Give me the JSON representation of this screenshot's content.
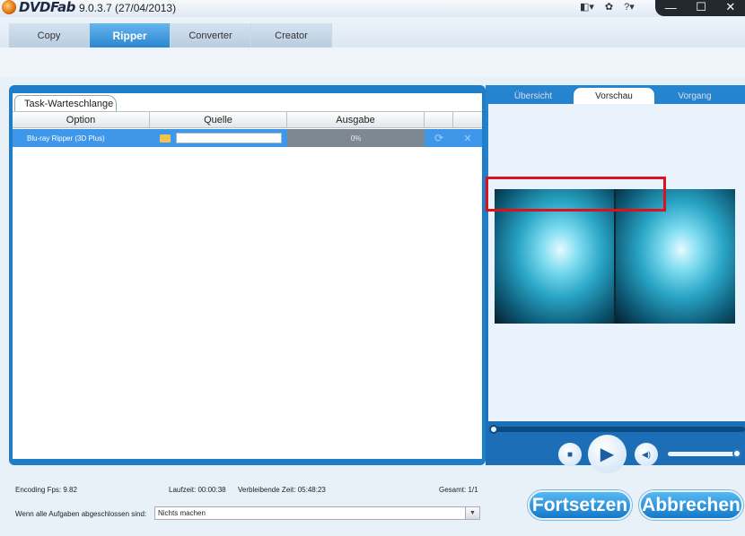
{
  "app": {
    "brand": "DVDFab",
    "version": "9.0.3.7 (27/04/2013)"
  },
  "titlebar": {
    "icons": [
      "◧▾",
      "✿",
      "?▾"
    ],
    "window_controls": [
      "—",
      "☐",
      "✕"
    ]
  },
  "tabs": [
    {
      "label": "Copy"
    },
    {
      "label": "Ripper",
      "active": true
    },
    {
      "label": "Converter"
    },
    {
      "label": "Creator"
    }
  ],
  "queue": {
    "tab_label": "Task-Warteschlange",
    "headers": [
      "Option",
      "Quelle",
      "Ausgabe",
      "",
      ""
    ],
    "rows": [
      {
        "option": "Blu-ray Ripper (3D Plus)",
        "source": "",
        "output": "0%"
      }
    ]
  },
  "right_tabs": [
    {
      "label": "Übersicht"
    },
    {
      "label": "Vorschau",
      "active": true
    },
    {
      "label": "Vorgang"
    }
  ],
  "status": {
    "fps": "Encoding Fps: 9.82",
    "laufzeit": "Laufzeit: 00:00:38",
    "remaining": "Verbleibende Zeit: 05:48:23",
    "total": "Gesamt: 1/1",
    "when_done_label": "Wenn alle Aufgaben abgeschlossen sind:",
    "when_done_value": "Nichts machen"
  },
  "buttons": {
    "resume": "Fortsetzen",
    "cancel": "Abbrechen"
  },
  "colors": {
    "accent": "#1e7fc8",
    "highlight": "#e0101a",
    "selected_row": "#3f97ea"
  },
  "icons": {
    "stop": "■",
    "play": "▶",
    "volume": "◀)",
    "refresh": "⟳",
    "close": "✕"
  }
}
